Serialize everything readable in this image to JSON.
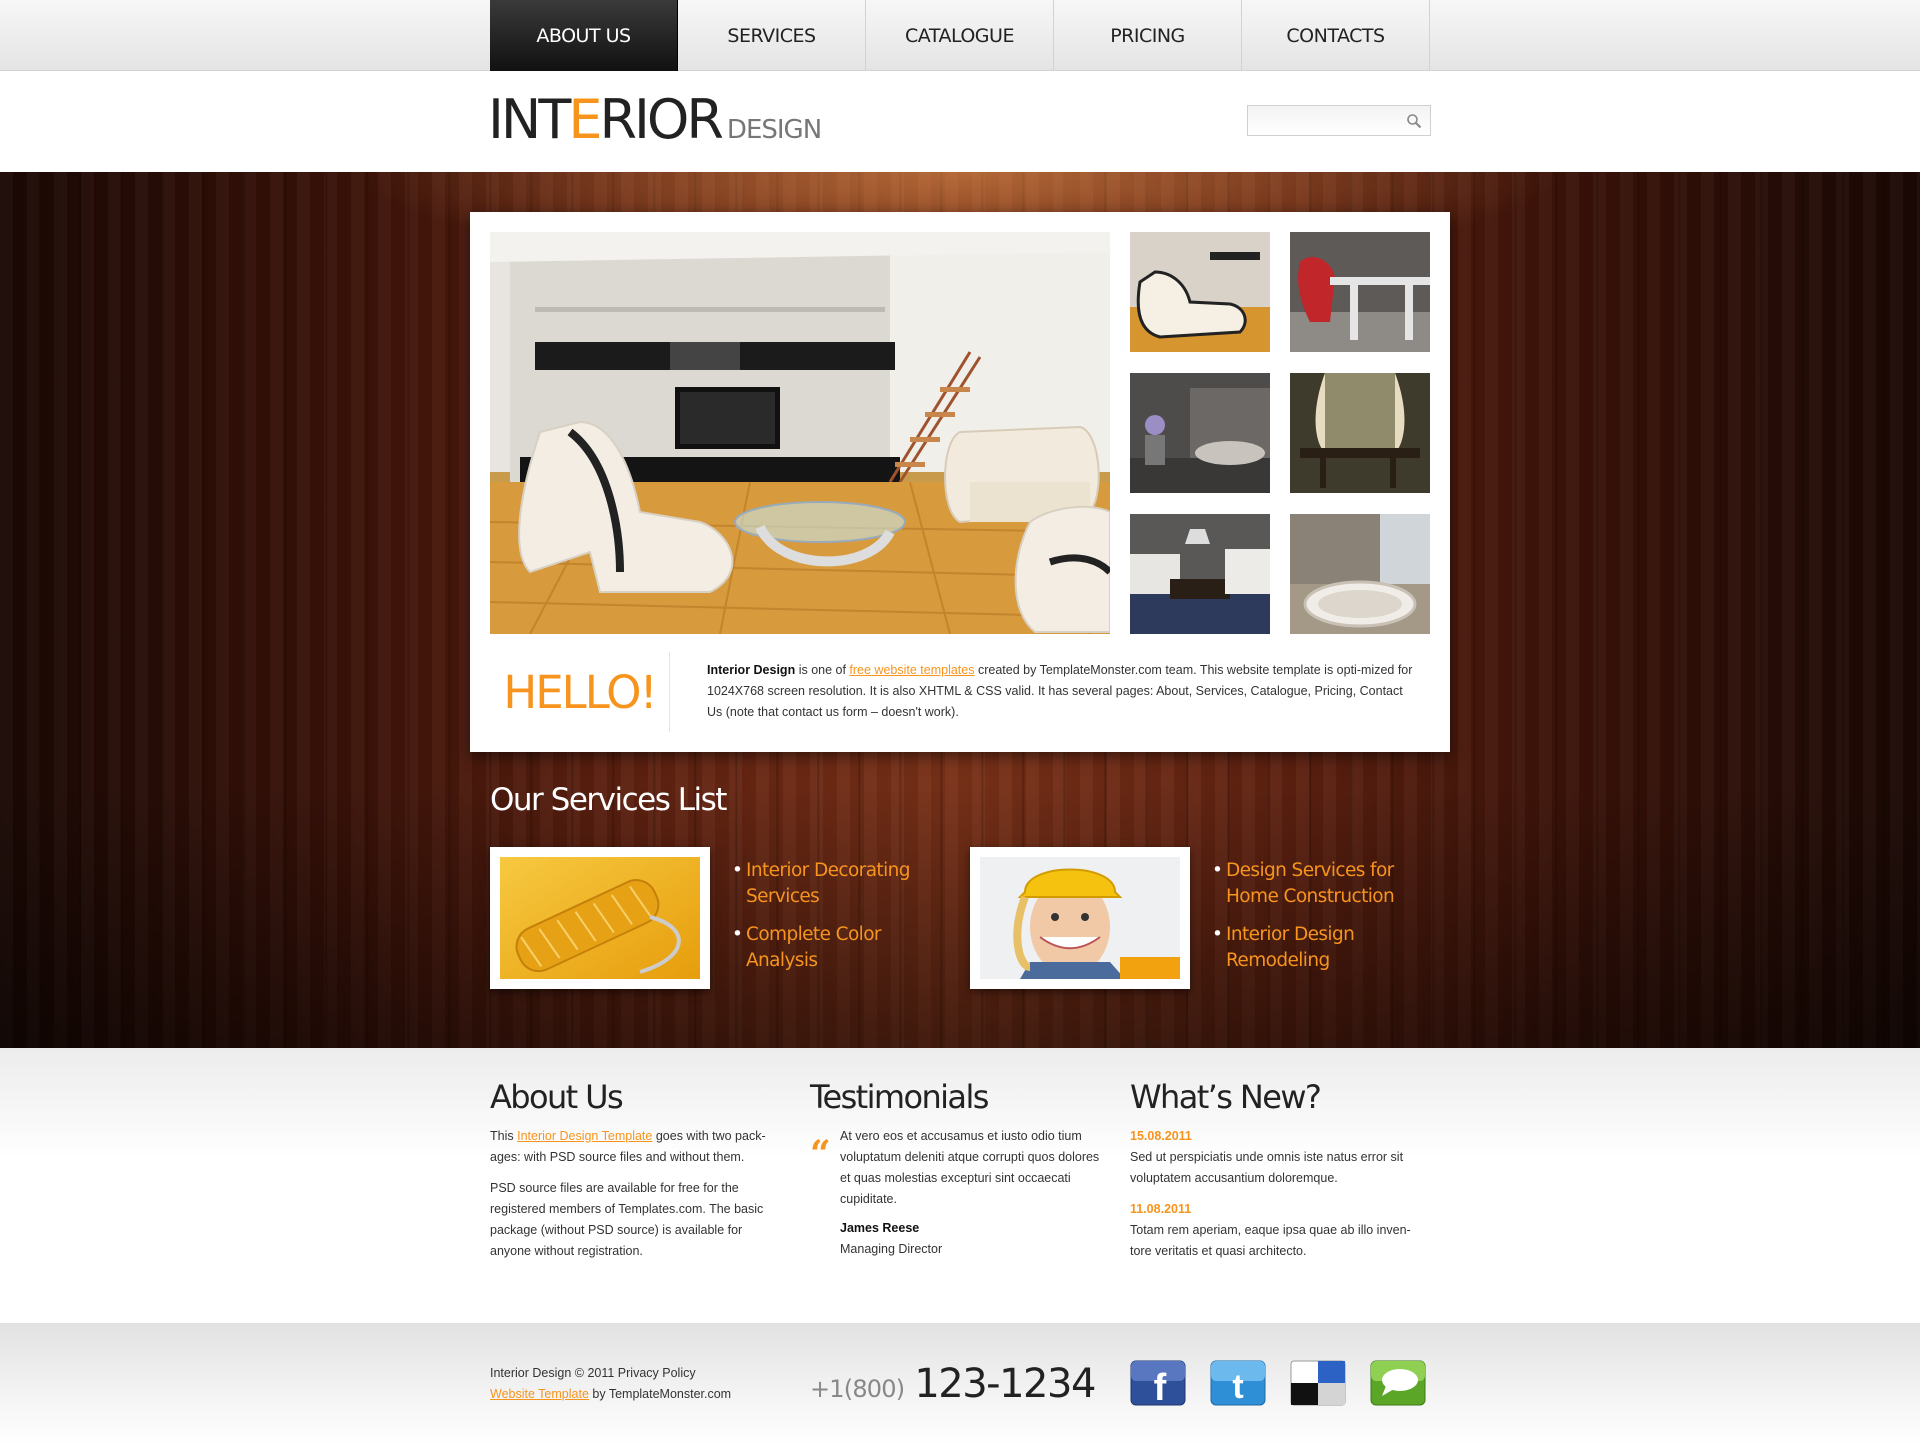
{
  "nav": {
    "items": [
      {
        "label": "ABOUT US"
      },
      {
        "label": "SERVICES"
      },
      {
        "label": "CATALOGUE"
      },
      {
        "label": "PRICING"
      },
      {
        "label": "CONTACTS"
      }
    ],
    "active_index": 0
  },
  "header": {
    "logo_part1": "INT",
    "logo_accent": "E",
    "logo_part2": "RIOR",
    "logo_sub": "DESIGN",
    "search_value": ""
  },
  "showcase": {
    "hello": "HELLO!",
    "intro_brand": "Interior Design",
    "intro_pre": " is one of ",
    "intro_link": "free website templates",
    "intro_post": " created by TemplateMonster.com team. This website template is opti-mized for 1024X768 screen resolution. It is also XHTML & CSS valid. It has several pages: About, Services, Catalogue, Pricing, Contact Us (note that contact us form – doesn't work)."
  },
  "services": {
    "title": "Our Services List",
    "list1": [
      "Interior Decorating Services",
      "Complete Color Analysis"
    ],
    "list2": [
      "Design Services for Home Construction",
      "Interior Design Remodeling"
    ]
  },
  "about": {
    "title": "About Us",
    "p1_pre": "This ",
    "p1_link": "Interior Design Template",
    "p1_post": " goes with two pack-ages: with PSD source files and without them.",
    "p2": "PSD source files are available for free for the registered members of Templates.com. The basic package (without PSD source) is available for anyone without registration."
  },
  "testimonials": {
    "title": "Testimonials",
    "quote": "At vero eos et accusamus et iusto odio tium voluptatum deleniti atque corrupti quos dolores et quas molestias excepturi sint occaecati cupiditate.",
    "name": "James Reese",
    "role": "Managing Director"
  },
  "news": {
    "title": "What’s New?",
    "items": [
      {
        "date": "15.08.2011",
        "text": "Sed ut perspiciatis unde omnis iste natus error sit voluptatem accusantium doloremque."
      },
      {
        "date": "11.08.2011",
        "text": "Totam rem aperiam, eaque ipsa quae ab illo inven-tore veritatis et quasi architecto."
      }
    ]
  },
  "footer": {
    "copyright": "Interior Design © 2011 Privacy Policy",
    "template_link": "Website Template",
    "template_by": " by TemplateMonster.com",
    "phone_prefix": "+1(800)",
    "phone_number": "123-1234",
    "social": [
      "facebook-icon",
      "twitter-icon",
      "delicious-icon",
      "chat-icon"
    ]
  },
  "colors": {
    "accent": "#f7941d",
    "nav_active": "#1a1a1a",
    "wood": "#6a2a14"
  }
}
